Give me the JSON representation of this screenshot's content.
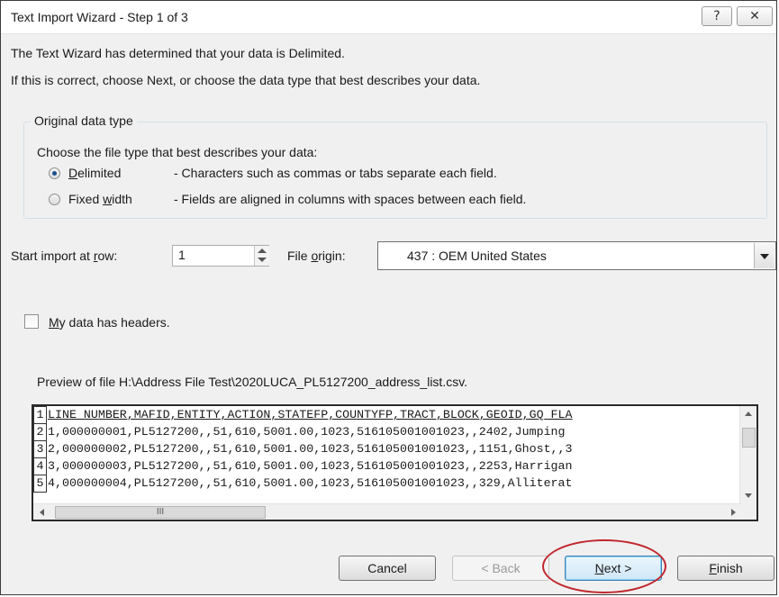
{
  "window": {
    "title": "Text Import Wizard - Step 1 of 3",
    "help_glyph": "?",
    "close_glyph": "✕"
  },
  "intro": {
    "line1": "The Text Wizard has determined that your data is Delimited.",
    "line2": "If this is correct, choose Next, or choose the data type that best describes your data."
  },
  "original_data_type": {
    "legend": "Original data type",
    "prompt": "Choose the file type that best describes your data:",
    "options": [
      {
        "label": "Delimited",
        "mnemonic": "D",
        "description": "- Characters such as commas or tabs separate each field.",
        "checked": true
      },
      {
        "label": "Fixed width",
        "mnemonic": "w",
        "description": "- Fields are aligned in columns with spaces between each field.",
        "checked": false
      }
    ]
  },
  "start_row": {
    "label_prefix": "Start import at ",
    "label_mnemonic": "r",
    "label_suffix": "ow:",
    "value": "1"
  },
  "file_origin": {
    "label_prefix": "File ",
    "label_mnemonic": "o",
    "label_suffix": "rigin:",
    "value": "437 : OEM United States"
  },
  "headers_checkbox": {
    "label_mnemonic": "M",
    "label_rest": "y data has headers.",
    "checked": false
  },
  "preview": {
    "caption": "Preview of file H:\\Address File Test\\2020LUCA_PL5127200_address_list.csv.",
    "lines": [
      {
        "num": "1",
        "text": "LINE_NUMBER,MAFID,ENTITY,ACTION,STATEFP,COUNTYFP,TRACT,BLOCK,GEOID,GQ_FLA"
      },
      {
        "num": "2",
        "text": "1,000000001,PL5127200,,51,610,5001.00,1023,516105001001023,,2402,Jumping"
      },
      {
        "num": "3",
        "text": "2,000000002,PL5127200,,51,610,5001.00,1023,516105001001023,,1151,Ghost,,3"
      },
      {
        "num": "4",
        "text": "3,000000003,PL5127200,,51,610,5001.00,1023,516105001001023,,2253,Harrigan"
      },
      {
        "num": "5",
        "text": "4,000000004,PL5127200,,51,610,5001.00,1023,516105001001023,,329,Alliterat"
      }
    ],
    "hscroll_grip": "III"
  },
  "buttons": {
    "cancel": "Cancel",
    "back_mnemonic": "< ",
    "back": "< Back",
    "next_mnemonic": "N",
    "next_rest": "ext >",
    "finish_mnemonic": "F",
    "finish_rest": "inish"
  },
  "colors": {
    "highlight_ellipse": "#c0272d",
    "radio_dot": "#1e4f8f"
  }
}
